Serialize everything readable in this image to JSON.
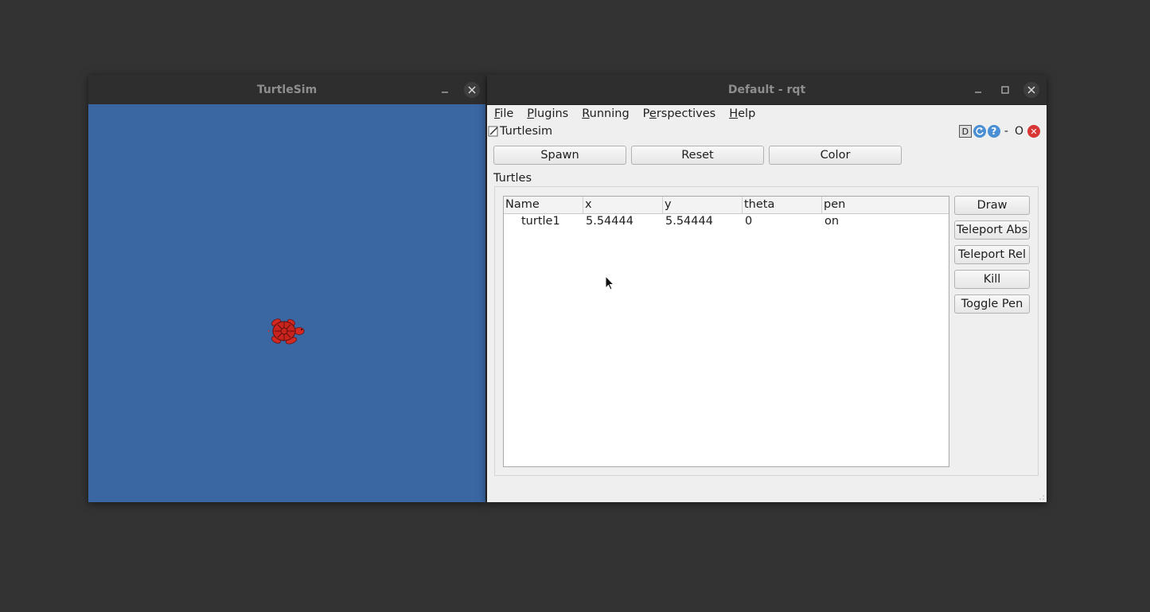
{
  "turtlesim_window": {
    "title": "TurtleSim",
    "background_color": "#3a66a2"
  },
  "rqt_window": {
    "title": "Default - rqt",
    "menu": [
      {
        "pre": "",
        "mnemonic": "F",
        "post": "ile"
      },
      {
        "pre": "",
        "mnemonic": "P",
        "post": "lugins"
      },
      {
        "pre": "",
        "mnemonic": "R",
        "post": "unning"
      },
      {
        "pre": "P",
        "mnemonic": "e",
        "post": "rspectives"
      },
      {
        "pre": "",
        "mnemonic": "H",
        "post": "elp"
      }
    ],
    "plugin": {
      "title": "Turtlesim",
      "controls": {
        "d_label": "D",
        "dash_label": "-",
        "o_label": "O"
      }
    },
    "buttons": {
      "spawn": "Spawn",
      "reset": "Reset",
      "color": "Color"
    },
    "section_label": "Turtles",
    "table": {
      "columns": [
        "Name",
        "x",
        "y",
        "theta",
        "pen"
      ],
      "rows": [
        {
          "name": "turtle1",
          "x": "5.54444",
          "y": "5.54444",
          "theta": "0",
          "pen": "on"
        }
      ]
    },
    "side_buttons": [
      "Draw",
      "Teleport Abs",
      "Teleport Rel",
      "Kill",
      "Toggle Pen"
    ]
  },
  "colors": {
    "desktop": "#333333",
    "titlebar": "#2e2e2e",
    "turtle": "#d22a22"
  }
}
